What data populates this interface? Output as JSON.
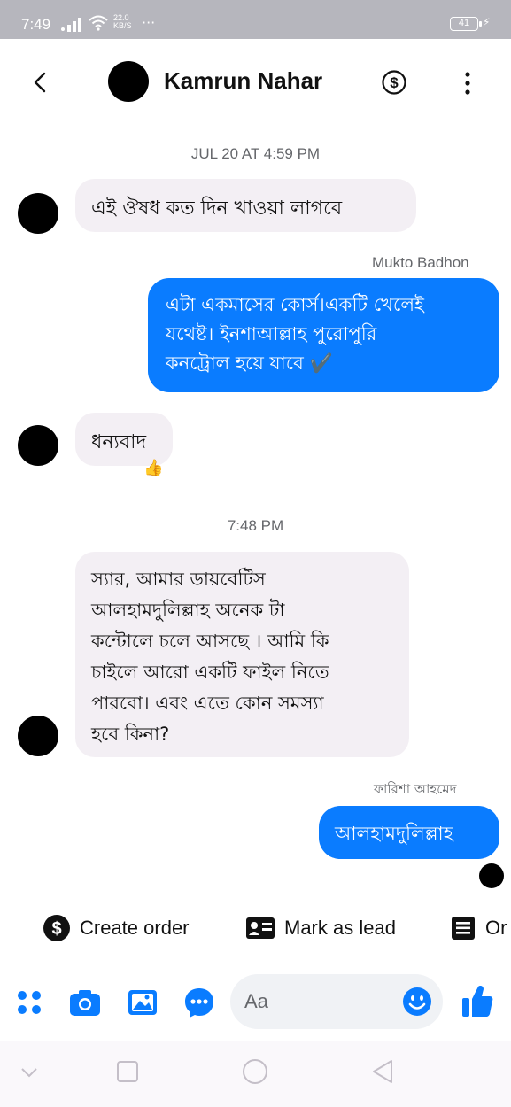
{
  "status_bar": {
    "time": "7:49",
    "net_speed_value": "22.0",
    "net_speed_unit": "KB/S",
    "more": "···",
    "battery": "41",
    "charging_icon": "bolt-icon"
  },
  "header": {
    "contact_name": "Kamrun Nahar",
    "icons": [
      "back-arrow-icon",
      "dollar-circle-icon",
      "more-vertical-icon"
    ]
  },
  "conversation": {
    "timestamp_1": "JUL 20 AT 4:59 PM",
    "msg_1": "এই ঔষধ কত দিন খাওয়া লাগবে",
    "sender_1": "Mukto Badhon",
    "msg_2_lines": [
      "এটা একমাসের কোর্স।একটি খেলেই",
      "যথেষ্ট। ইনশাআল্লাহ পুরোপুরি",
      "কনট্রোল হয়ে যাবে ✔️"
    ],
    "msg_3": "ধন্যবাদ",
    "msg_3_emoji": "👍",
    "timestamp_2": "7:48 PM",
    "msg_4_lines": [
      "স্যার,  আমার ডায়বেটিস",
      "আলহামদুলিল্লাহ  অনেক টা",
      "কন্টোলে চলে আসছে । আমি কি",
      "চাইলে  আরো একটি  ফাইল  নিতে",
      "পারবো।  এবং এতে কোন সমস্যা",
      "হবে কিনা?"
    ],
    "sender_2": "ফারিশা আহমেদ",
    "msg_5": "আলহামদুলিল্লাহ"
  },
  "quick_actions": [
    {
      "label": "Create order",
      "icon": "dollar-circle-icon"
    },
    {
      "label": "Mark as lead",
      "icon": "id-card-icon"
    },
    {
      "label": "Or",
      "icon": "receipt-icon"
    }
  ],
  "composer": {
    "placeholder": "Aa",
    "icons": [
      "apps-icon",
      "camera-icon",
      "gallery-icon",
      "chat-bubble-icon",
      "emoji-icon",
      "thumbs-up-icon"
    ],
    "accent": "#0a7cff"
  },
  "nav_bar": {
    "icons": [
      "chevron-down-icon",
      "recents-icon",
      "home-icon",
      "back-icon"
    ]
  },
  "colors": {
    "outgoing_bubble": "#0a7cff",
    "incoming_bubble": "#f3eff4",
    "status_bar": "#b6b6bd"
  }
}
